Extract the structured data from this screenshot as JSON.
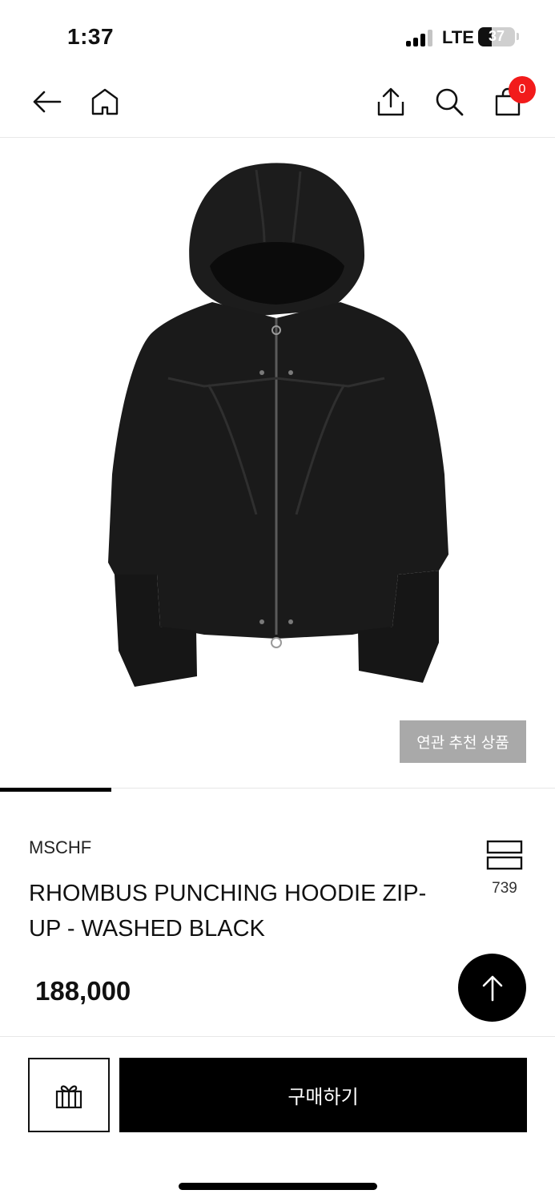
{
  "status_bar": {
    "time": "1:37",
    "network": "LTE",
    "battery": "37"
  },
  "header": {
    "cart_count": "0"
  },
  "hero": {
    "related_button": "연관 추천 상품",
    "image_progress": 0.2
  },
  "product": {
    "brand": "MSCHF",
    "name": "RHOMBUS PUNCHING HOODIE ZIP-UP - WASHED BLACK",
    "like_count": "739",
    "price": "188,000"
  },
  "actions": {
    "buy_label": "구매하기"
  },
  "icons": [
    "back-arrow-icon",
    "home-icon",
    "share-icon",
    "search-icon",
    "cart-icon",
    "like-icon",
    "arrow-up-icon",
    "gift-icon"
  ]
}
